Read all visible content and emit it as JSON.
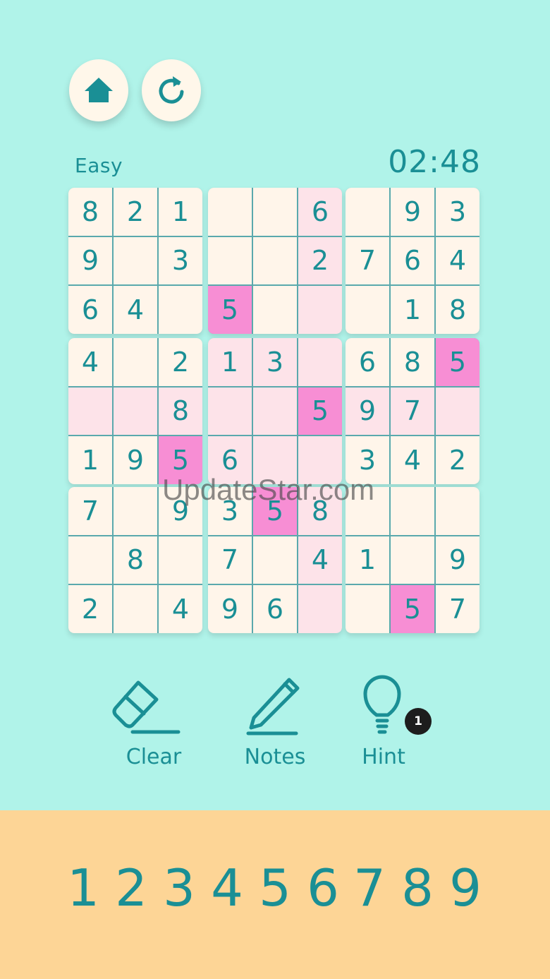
{
  "header": {
    "difficulty": "Easy",
    "timer": "02:48"
  },
  "board": {
    "rows": [
      [
        "8",
        "2",
        "1",
        "",
        "",
        "6",
        "",
        "9",
        "3"
      ],
      [
        "9",
        "",
        "3",
        "",
        "",
        "2",
        "7",
        "6",
        "4"
      ],
      [
        "6",
        "4",
        "",
        "5",
        "",
        "",
        "",
        "1",
        "8"
      ],
      [
        "4",
        "",
        "2",
        "1",
        "3",
        "",
        "6",
        "8",
        "5"
      ],
      [
        "",
        "",
        "8",
        "",
        "",
        "5",
        "9",
        "7",
        ""
      ],
      [
        "1",
        "9",
        "5",
        "6",
        "",
        "",
        "3",
        "4",
        "2"
      ],
      [
        "7",
        "",
        "9",
        "3",
        "5",
        "8",
        "",
        "",
        ""
      ],
      [
        "",
        "8",
        "",
        "7",
        "",
        "4",
        "1",
        "",
        "9"
      ],
      [
        "2",
        "",
        "4",
        "9",
        "6",
        "",
        "",
        "5",
        "7"
      ]
    ],
    "highlight": [
      [
        0,
        0,
        0,
        0,
        0,
        1,
        0,
        0,
        0
      ],
      [
        0,
        0,
        0,
        0,
        0,
        1,
        0,
        0,
        0
      ],
      [
        0,
        0,
        0,
        2,
        0,
        1,
        0,
        0,
        0
      ],
      [
        0,
        0,
        0,
        1,
        1,
        1,
        0,
        0,
        2
      ],
      [
        1,
        1,
        1,
        1,
        1,
        2,
        1,
        1,
        1
      ],
      [
        0,
        0,
        2,
        1,
        1,
        1,
        0,
        0,
        0
      ],
      [
        0,
        0,
        0,
        0,
        2,
        1,
        0,
        0,
        0
      ],
      [
        0,
        0,
        0,
        0,
        0,
        1,
        0,
        0,
        0
      ],
      [
        0,
        0,
        0,
        0,
        0,
        1,
        0,
        2,
        0
      ]
    ]
  },
  "tools": {
    "clear": "Clear",
    "notes": "Notes",
    "hint": "Hint",
    "hint_count": "1"
  },
  "numpad": [
    "1",
    "2",
    "3",
    "4",
    "5",
    "6",
    "7",
    "8",
    "9"
  ],
  "watermark": "UpdateStar.com",
  "colors": {
    "background": "#b0f3e9",
    "accent": "#1a8f95",
    "cell": "#fff5ea",
    "highlight": "#fde3e9",
    "duplicate": "#f78ed4",
    "numpad_bg": "#fdd596"
  }
}
